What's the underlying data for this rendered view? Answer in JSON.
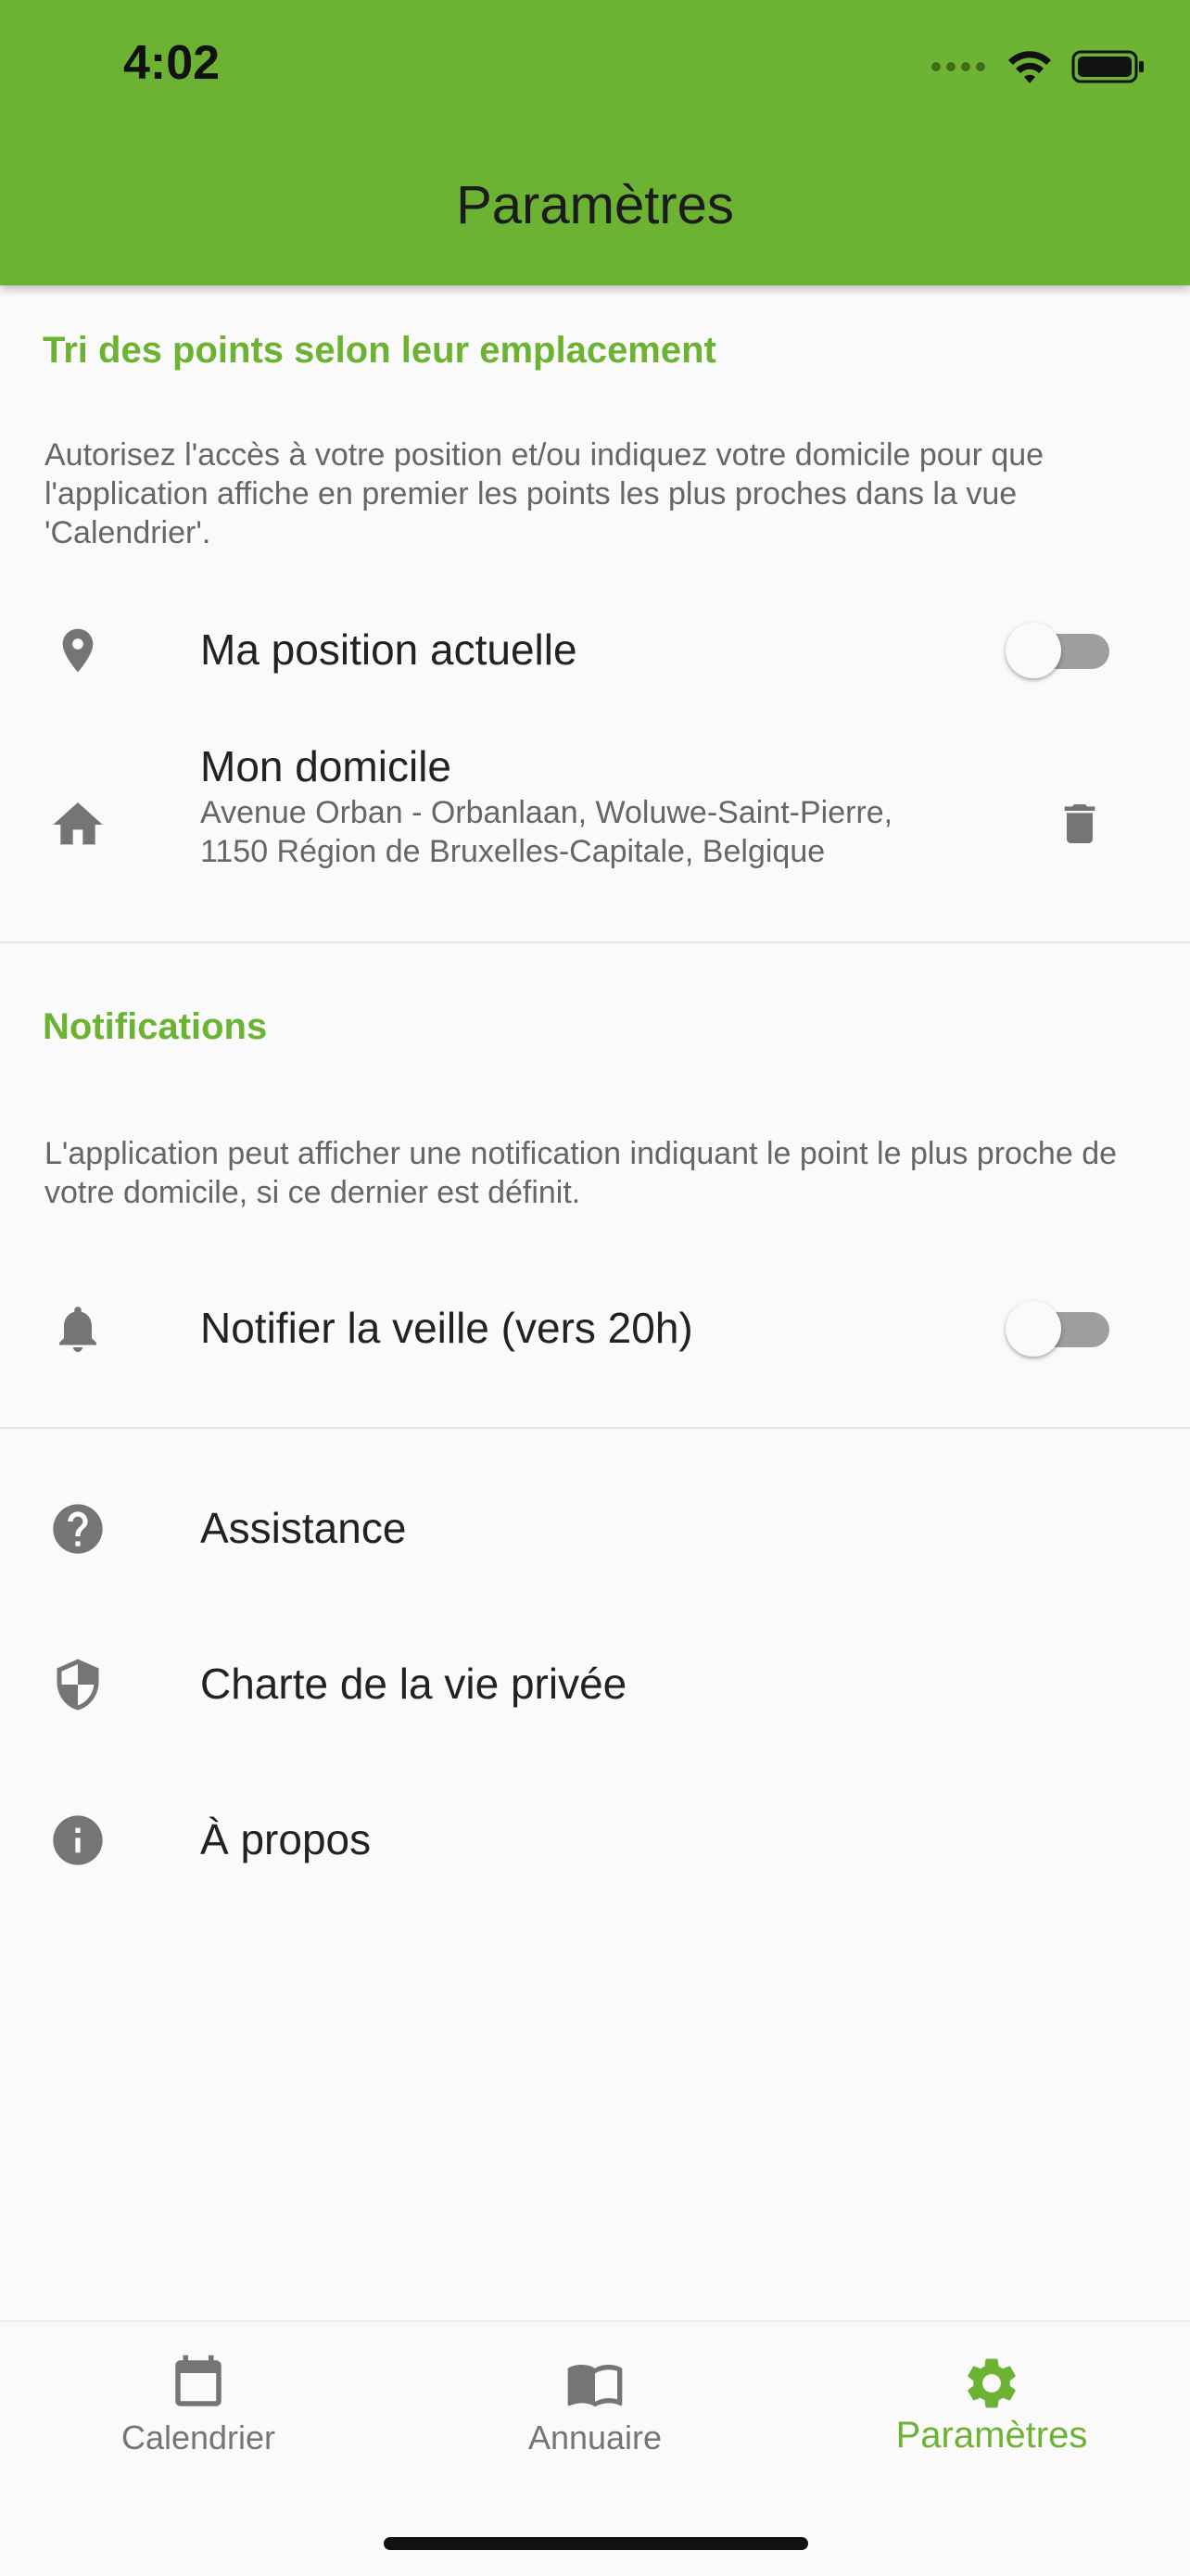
{
  "status_bar": {
    "time": "4:02"
  },
  "app_bar": {
    "title": "Paramètres"
  },
  "location_section": {
    "title": "Tri des points selon leur emplacement",
    "description": "Autorisez l'accès à votre position et/ou indiquez votre domicile pour que l'application affiche en premier les points les plus proches dans la vue 'Calendrier'.",
    "current_position": {
      "label": "Ma position actuelle",
      "enabled": false,
      "icon": "location-pin-icon"
    },
    "home": {
      "label": "Mon domicile",
      "address": "Avenue Orban - Orbanlaan, Woluwe-Saint-Pierre, 1150 Région de Bruxelles-Capitale, Belgique",
      "icon": "home-icon",
      "action_icon": "trash-icon"
    }
  },
  "notifications_section": {
    "title": "Notifications",
    "description": "L'application peut afficher une notification indiquant le point le plus proche de votre domicile, si ce dernier est définit.",
    "notify_eve": {
      "label": "Notifier la veille (vers 20h)",
      "enabled": false,
      "icon": "bell-icon"
    }
  },
  "links": [
    {
      "label": "Assistance",
      "icon": "help-circle-icon"
    },
    {
      "label": "Charte de la vie privée",
      "icon": "shield-icon"
    },
    {
      "label": "À propos",
      "icon": "info-icon"
    }
  ],
  "bottom_nav": {
    "items": [
      {
        "label": "Calendrier",
        "icon": "calendar-icon",
        "active": false
      },
      {
        "label": "Annuaire",
        "icon": "book-icon",
        "active": false
      },
      {
        "label": "Paramètres",
        "icon": "gear-icon",
        "active": true
      }
    ]
  },
  "colors": {
    "accent": "#6cb333",
    "icon_grey": "#757575",
    "background": "#fafafa"
  }
}
